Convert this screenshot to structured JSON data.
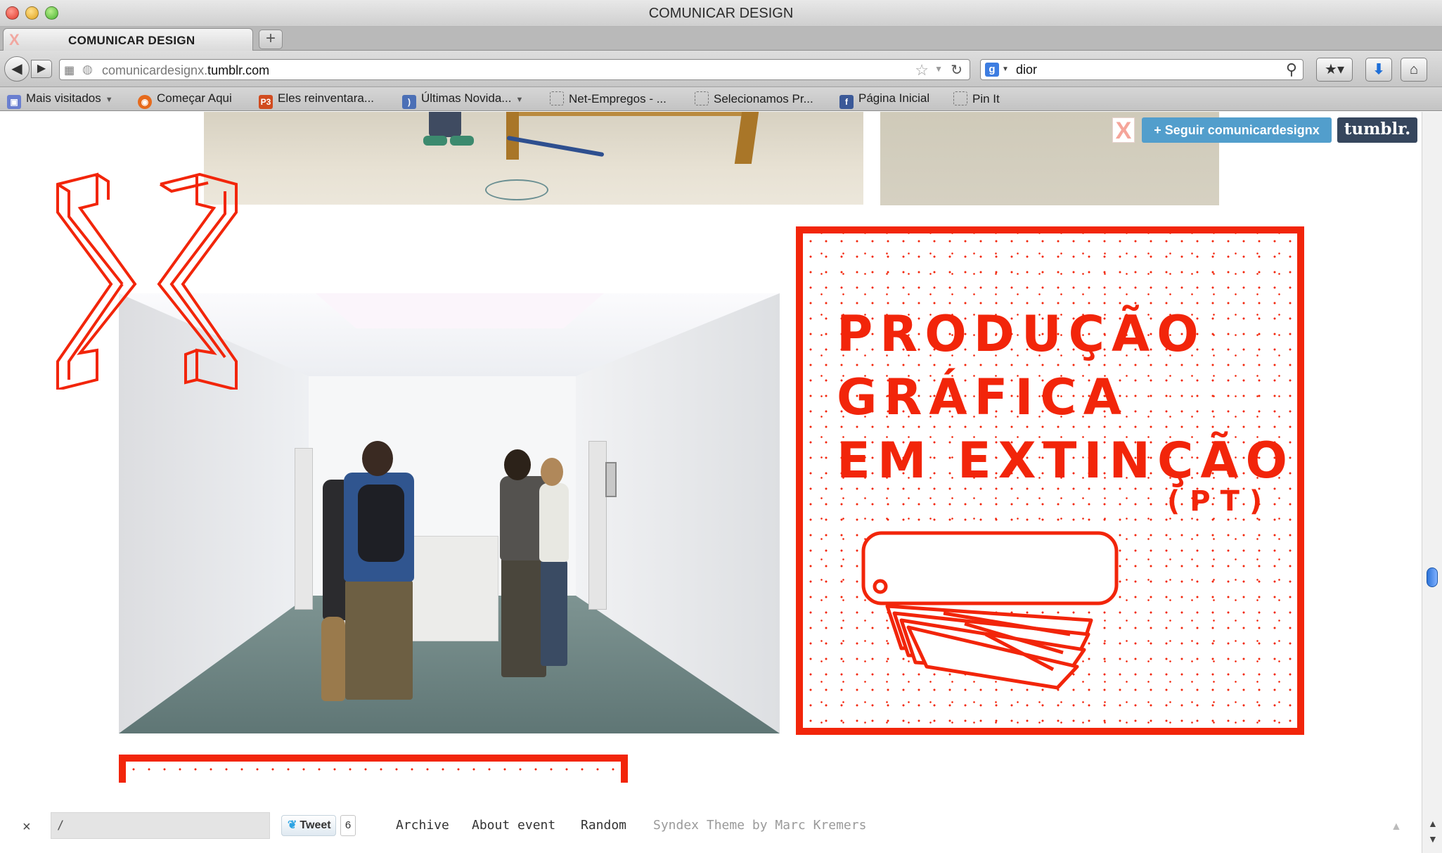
{
  "window": {
    "title": "COMUNICAR DESIGN"
  },
  "tab": {
    "title": "COMUNICAR DESIGN",
    "new_tab": "+"
  },
  "navbar": {
    "url_prefix": "comunicardesignx.",
    "url_host": "tumblr.com",
    "search_value": "dior",
    "back": "◀",
    "forward": "▶"
  },
  "bookmarks": [
    {
      "label": "Mais visitados",
      "icon": "most-visited-icon",
      "color": "#6a7fd0",
      "dropdown": true
    },
    {
      "label": "Começar Aqui",
      "icon": "firefox-icon",
      "color": "#e66a1c",
      "dropdown": false
    },
    {
      "label": "Eles reinventara...",
      "icon": "p3-icon",
      "color": "#d14b1f",
      "dropdown": false
    },
    {
      "label": "Últimas Novida...",
      "icon": "rss-icon",
      "color": "#4b6fb6",
      "dropdown": true
    },
    {
      "label": "Net-Empregos - ...",
      "icon": "page-icon",
      "color": "#ffffff",
      "dropdown": false
    },
    {
      "label": "Selecionamos Pr...",
      "icon": "page-icon",
      "color": "#ffffff",
      "dropdown": false
    },
    {
      "label": "Página Inicial",
      "icon": "facebook-icon",
      "color": "#3b5998",
      "dropdown": false
    },
    {
      "label": "Pin It",
      "icon": "page-icon",
      "color": "#ffffff",
      "dropdown": false
    }
  ],
  "tumblr_bar": {
    "follow_label": "+ Seguir comunicardesignx",
    "brand_label": "tumblr."
  },
  "poster": {
    "title_lines": [
      "PRODUÇÃO",
      "GRÁFICA",
      "EM EXTINÇÃO"
    ],
    "subtitle": "(PT)",
    "accent": "#f2250a"
  },
  "footer": {
    "close": "×",
    "search_value": "/",
    "tweet_label": "Tweet",
    "tweet_count": "6",
    "links": [
      "Archive",
      "About event",
      "Random"
    ],
    "credit": "Syndex Theme by Marc Kremers"
  },
  "colors": {
    "accent_red": "#f2250a",
    "tumblr_blue": "#529ecc",
    "tumblr_navy": "#36465d"
  }
}
